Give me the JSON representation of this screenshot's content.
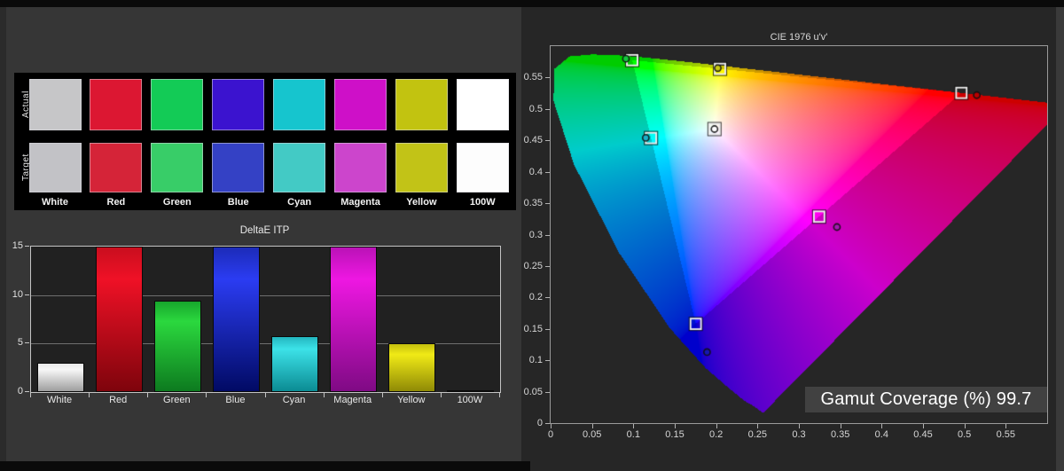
{
  "app": {
    "background": "#363636",
    "panel_background": "#262626",
    "black_panel": "#000000"
  },
  "swatch_panel": {
    "row_labels": [
      "Actual",
      "Target"
    ],
    "columns": [
      "White",
      "Red",
      "Green",
      "Blue",
      "Cyan",
      "Magenta",
      "Yellow",
      "100W"
    ],
    "actual_colors": [
      "#c6c6c8",
      "#dc1732",
      "#13cb56",
      "#3b13cf",
      "#16c5ce",
      "#ce10c8",
      "#c2c310",
      "#ffffff"
    ],
    "target_colors": [
      "#c2c2c6",
      "#d52438",
      "#38cd68",
      "#3441c5",
      "#43cac5",
      "#cc45cc",
      "#c2c317",
      "#fdfdfd"
    ]
  },
  "chart_data": [
    {
      "type": "bar",
      "title": "DeltaE ITP",
      "categories": [
        "White",
        "Red",
        "Green",
        "Blue",
        "Cyan",
        "Magenta",
        "Yellow",
        "100W"
      ],
      "values": [
        3.0,
        15,
        9.4,
        15,
        5.8,
        15,
        5.0,
        0.2
      ],
      "clipped_at_max": [
        "Red",
        "Blue",
        "Magenta"
      ],
      "ylim": [
        0,
        15
      ],
      "yticks": [
        "0",
        "5",
        "10",
        "15"
      ],
      "grid": "horizontal",
      "bar_gradients": [
        {
          "top": "#e9e9e9",
          "mid": "#f6f6f6",
          "bottom": "#9e9e9e"
        },
        {
          "top": "#c90e1e",
          "mid": "#ef1126",
          "bottom": "#7e040c"
        },
        {
          "top": "#17a62c",
          "mid": "#2bd83e",
          "bottom": "#0d7a1f"
        },
        {
          "top": "#1c2bb8",
          "mid": "#2b3cf2",
          "bottom": "#010a64"
        },
        {
          "top": "#23b6c0",
          "mid": "#3ce2e8",
          "bottom": "#0b8b93"
        },
        {
          "top": "#ba12b6",
          "mid": "#ee17e2",
          "bottom": "#7f0a84"
        },
        {
          "top": "#c4be0e",
          "mid": "#f0ea16",
          "bottom": "#8f8a06"
        },
        {
          "top": "#f0f0f0",
          "mid": "#ffffff",
          "bottom": "#d0d0d0"
        }
      ]
    },
    {
      "type": "scatter",
      "title": "CIE 1976 u'v'",
      "xlim": [
        0,
        0.6
      ],
      "ylim": [
        0,
        0.6
      ],
      "xticks": [
        "0",
        "0.05",
        "0.1",
        "0.15",
        "0.2",
        "0.25",
        "0.3",
        "0.35",
        "0.4",
        "0.45",
        "0.5",
        "0.55"
      ],
      "yticks": [
        "0",
        "0.05",
        "0.1",
        "0.15",
        "0.2",
        "0.25",
        "0.3",
        "0.35",
        "0.4",
        "0.45",
        "0.5",
        "0.55"
      ],
      "gamut_coverage_label": "Gamut Coverage (%) 99.7",
      "reference_triangle_uv": [
        [
          0.0986,
          0.5777
        ],
        [
          0.4964,
          0.5256
        ],
        [
          0.1754,
          0.1579
        ]
      ],
      "targets": [
        {
          "name": "white",
          "u": 0.198,
          "v": 0.468
        },
        {
          "name": "red",
          "u": 0.4964,
          "v": 0.5256
        },
        {
          "name": "green",
          "u": 0.0986,
          "v": 0.5777
        },
        {
          "name": "blue",
          "u": 0.1754,
          "v": 0.1579
        },
        {
          "name": "cyan",
          "u": 0.1213,
          "v": 0.4537
        },
        {
          "name": "magenta",
          "u": 0.3245,
          "v": 0.3286
        },
        {
          "name": "yellow",
          "u": 0.2047,
          "v": 0.5638
        }
      ],
      "measured": [
        {
          "name": "white",
          "u": 0.198,
          "v": 0.468,
          "color": "#ffffff"
        },
        {
          "name": "red",
          "u": 0.515,
          "v": 0.522,
          "color": "#b80000"
        },
        {
          "name": "green",
          "u": 0.091,
          "v": 0.58,
          "color": "#12c83c"
        },
        {
          "name": "blue",
          "u": 0.189,
          "v": 0.113,
          "color": "#1616b4"
        },
        {
          "name": "cyan",
          "u": 0.115,
          "v": 0.454,
          "color": "#1ab0c8"
        },
        {
          "name": "magenta",
          "u": 0.346,
          "v": 0.312,
          "color": "#a616b4"
        },
        {
          "name": "yellow",
          "u": 0.202,
          "v": 0.565,
          "color": "#c8c814"
        }
      ]
    }
  ]
}
